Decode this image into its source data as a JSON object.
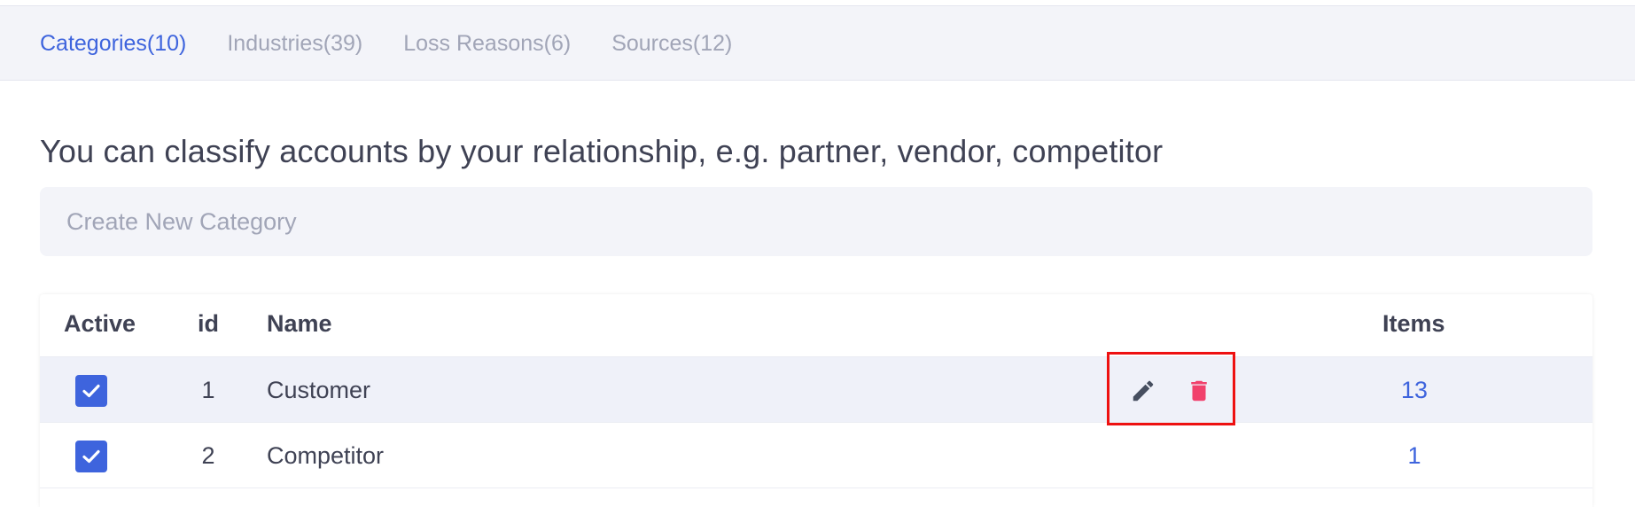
{
  "tabs": [
    {
      "label": "Categories(10)",
      "active": true
    },
    {
      "label": "Industries(39)",
      "active": false
    },
    {
      "label": "Loss Reasons(6)",
      "active": false
    },
    {
      "label": "Sources(12)",
      "active": false
    }
  ],
  "description": "You can classify accounts by your relationship, e.g. partner, vendor, competitor",
  "create_input": {
    "placeholder": "Create New Category",
    "value": ""
  },
  "table": {
    "headers": {
      "active": "Active",
      "id": "id",
      "name": "Name",
      "items": "Items"
    },
    "rows": [
      {
        "active": true,
        "id": "1",
        "name": "Customer",
        "items": "13",
        "hovered": true
      },
      {
        "active": true,
        "id": "2",
        "name": "Competitor",
        "items": "1",
        "hovered": false
      }
    ]
  },
  "icons": {
    "edit": "pencil-icon",
    "delete": "trash-icon",
    "check": "check-icon"
  },
  "colors": {
    "accent": "#3e64dd",
    "muted_tab": "#a1a5b7",
    "delete": "#f1416c",
    "edit": "#464e5f",
    "highlight": "#ee1111"
  }
}
